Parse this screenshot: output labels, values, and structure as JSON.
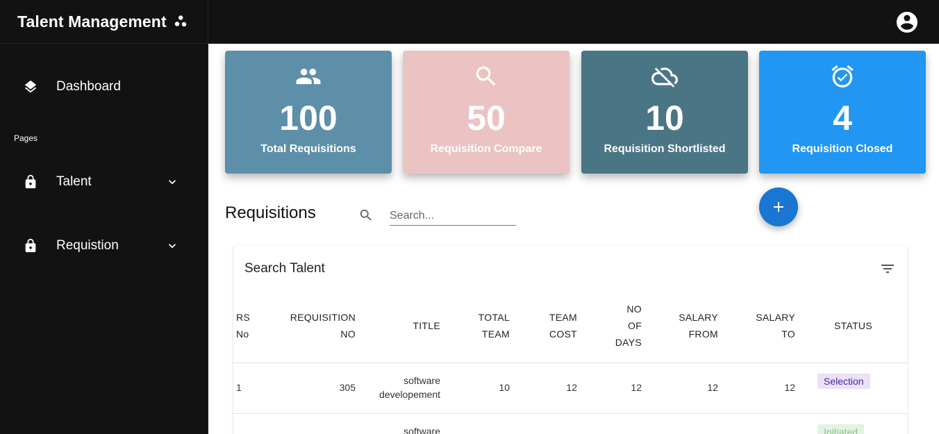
{
  "app": {
    "title": "Talent Management"
  },
  "sidebar": {
    "items": [
      {
        "label": "Dashboard"
      },
      {
        "label": "Talent"
      },
      {
        "label": "Requistion"
      }
    ],
    "section_label": "Pages"
  },
  "stats": [
    {
      "value": "100",
      "label": "Total Requisitions",
      "bg": "#5d8fa8",
      "icon": "group-icon"
    },
    {
      "value": "50",
      "label": "Requisition Compare",
      "bg": "#ebc3c3",
      "icon": "search-icon"
    },
    {
      "value": "10",
      "label": "Requisition Shortlisted",
      "bg": "#4a7585",
      "icon": "cloud-off-icon"
    },
    {
      "value": "4",
      "label": "Requisition Closed",
      "bg": "#2196f3",
      "icon": "alarm-on-icon"
    }
  ],
  "requisitions": {
    "title": "Requisitions",
    "search_placeholder": "Search..."
  },
  "table": {
    "title": "Search Talent",
    "headers": [
      "RS No",
      "REQUISITION NO",
      "TITLE",
      "TOTAL TEAM",
      "TEAM COST",
      "NO OF DAYS",
      "SALARY FROM",
      "SALARY TO",
      "STATUS"
    ],
    "rows": [
      {
        "rs_no": "1",
        "req_no": "305",
        "title": "software developement",
        "total_team": "10",
        "team_cost": "12",
        "days": "12",
        "salary_from": "12",
        "salary_to": "12",
        "status": "Selection"
      },
      {
        "rs_no": "",
        "req_no": "",
        "title": "software",
        "total_team": "",
        "team_cost": "",
        "days": "",
        "salary_from": "",
        "salary_to": "",
        "status": "Initiated"
      }
    ]
  },
  "colors": {
    "sidebar_bg": "#121212",
    "accent": "#1976d2",
    "status_selection_bg": "#ede0f7",
    "status_selection_fg": "#3d2aa8",
    "status_initiated_bg": "#e3f2e3",
    "status_initiated_fg": "#8bc48b"
  }
}
